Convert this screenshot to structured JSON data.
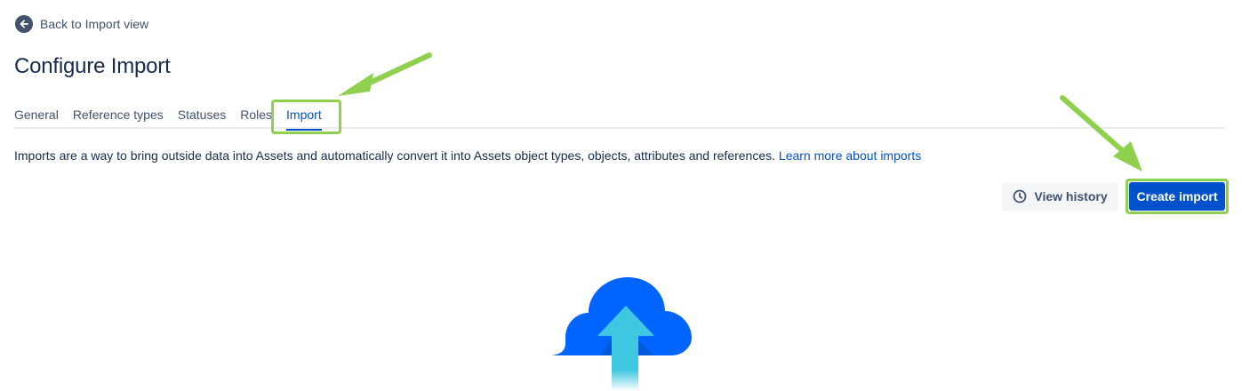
{
  "back_link": {
    "label": "Back to Import view",
    "icon": "arrow-left-circle-icon"
  },
  "page": {
    "title": "Configure Import"
  },
  "tabs": [
    {
      "label": "General",
      "active": false
    },
    {
      "label": "Reference types",
      "active": false
    },
    {
      "label": "Statuses",
      "active": false
    },
    {
      "label": "Roles",
      "active": false
    },
    {
      "label": "Import",
      "active": true
    }
  ],
  "intro": {
    "text": "Imports are a way to bring outside data into Assets and automatically convert it into Assets object types, objects, attributes and references.",
    "link": "Learn more about imports"
  },
  "actions": {
    "view_history": {
      "label": "View history",
      "icon": "clock-icon"
    },
    "create_import": {
      "label": "Create import"
    }
  },
  "illustration": {
    "icon": "cloud-upload-icon"
  },
  "colors": {
    "primary": "#0052cc",
    "text": "#172b4d",
    "subtle_text": "#42526e",
    "annotation": "#8fd14f",
    "cloud": "#0065ff",
    "arrow": "#3ec7e0"
  }
}
